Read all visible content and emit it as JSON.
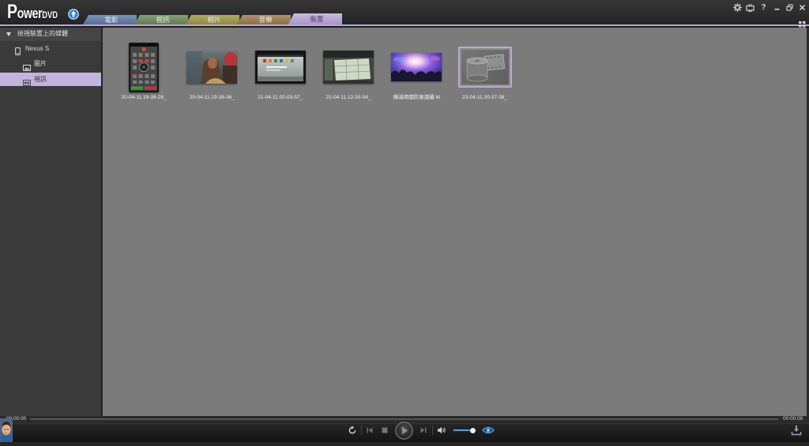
{
  "app": {
    "logo_main": "Power",
    "logo_sub": "DVD",
    "upgrade_icon": "upgrade-arrow-icon"
  },
  "tabs": [
    {
      "label": "電影",
      "color": "#5c7ca4",
      "active": false
    },
    {
      "label": "視訊",
      "color": "#6c8a5a",
      "active": false
    },
    {
      "label": "相片",
      "color": "#9e9849",
      "active": false
    },
    {
      "label": "音樂",
      "color": "#9c7b4e",
      "active": false
    },
    {
      "label": "裝置",
      "color": "#bca9dc",
      "active": true
    }
  ],
  "window_controls": {
    "settings_icon": "gear-icon",
    "display_icon": "tv-icon",
    "help_label": "?",
    "minimize_icon": "minimize-icon",
    "restore_icon": "restore-icon",
    "close_icon": "close-icon",
    "view_mode_icon": "grid-view-icon"
  },
  "sidebar": {
    "header": "檢視裝置上的媒體",
    "device": {
      "label": "Nexus S",
      "icon": "phone-icon"
    },
    "items": [
      {
        "label": "圖片",
        "icon": "picture-icon",
        "selected": false
      },
      {
        "label": "視訊",
        "icon": "video-icon",
        "selected": true
      }
    ]
  },
  "media": {
    "items": [
      {
        "label": "20-04-11.19-36-28_",
        "selected": false
      },
      {
        "label": "20-04-11.19-38-36_",
        "selected": false
      },
      {
        "label": "21-04-11.00-03-57_",
        "selected": false
      },
      {
        "label": "21-04-11.12-33-54_",
        "selected": false
      },
      {
        "label": "陳滿堉國防會議優.M",
        "selected": false
      },
      {
        "label": "23-04-11.20-37-38_",
        "selected": true
      }
    ]
  },
  "player": {
    "time_elapsed": "00:00:00",
    "time_total": "00:00:00",
    "progress": 0,
    "volume": 0.96,
    "controls": [
      "repeat-icon",
      "previous-icon",
      "stop-icon",
      "play-icon",
      "next-icon",
      "volume-icon",
      "3d-eye-icon",
      "download-icon"
    ]
  },
  "colors": {
    "accent": "#bca9dc",
    "content_bg": "#7b7b7b",
    "sidebar_bg": "#3a3a3a",
    "volume_fill": "#4ea2e6"
  }
}
